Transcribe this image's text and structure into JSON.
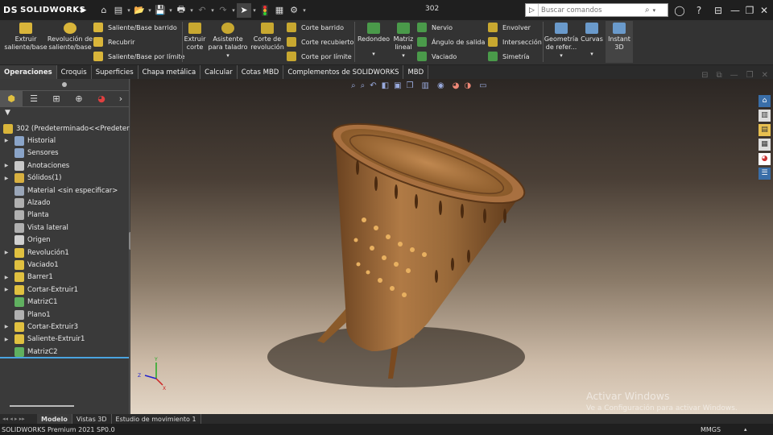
{
  "app": {
    "name": "SOLIDWORKS",
    "brand_mark": "DS",
    "document_title": "302"
  },
  "search": {
    "placeholder": "Buscar comandos"
  },
  "ribbon": {
    "extruir_saliente": "Extruir\nsaliente/base",
    "revolucion_saliente": "Revolución de\nsaliente/base",
    "saliente_barrido": "Saliente/Base barrido",
    "recubrir": "Recubrir",
    "saliente_limite": "Saliente/Base por límite",
    "extruir_corte": "Extruir\ncorte",
    "asistente_taladro": "Asistente\npara taladro",
    "corte_revolucion": "Corte de\nrevolución",
    "corte_barrido": "Corte barrido",
    "corte_recubierto": "Corte recubierto",
    "corte_limite": "Corte por límite",
    "redondeo": "Redondeo",
    "matriz_lineal": "Matriz\nlineal",
    "nervio": "Nervio",
    "angulo_salida": "Ángulo de salida",
    "vaciado": "Vaciado",
    "envolver": "Envolver",
    "interseccion": "Intersección",
    "simetria": "Simetría",
    "geometria_referencia": "Geometría\nde refer...",
    "curvas": "Curvas",
    "instant3d": "Instant\n3D"
  },
  "tabs": [
    "Operaciones",
    "Croquis",
    "Superficies",
    "Chapa metálica",
    "Calcular",
    "Cotas MBD",
    "Complementos de SOLIDWORKS",
    "MBD"
  ],
  "feature_tree": {
    "root": "302  (Predeterminado<<Predeterminado>",
    "items": [
      {
        "label": "Historial",
        "expandable": true,
        "icon_color": "#8aa4c8"
      },
      {
        "label": "Sensores",
        "expandable": false,
        "icon_color": "#8aa4c8"
      },
      {
        "label": "Anotaciones",
        "expandable": true,
        "icon_color": "#c8c8c8"
      },
      {
        "label": "Sólidos(1)",
        "expandable": true,
        "icon_color": "#d8b040"
      },
      {
        "label": "Material <sin especificar>",
        "expandable": false,
        "icon_color": "#9aa6b8"
      },
      {
        "label": "Alzado",
        "expandable": false,
        "icon_color": "#b0b0b0"
      },
      {
        "label": "Planta",
        "expandable": false,
        "icon_color": "#b0b0b0"
      },
      {
        "label": "Vista lateral",
        "expandable": false,
        "icon_color": "#b0b0b0"
      },
      {
        "label": "Origen",
        "expandable": false,
        "icon_color": "#d0d0d0"
      },
      {
        "label": "Revolución1",
        "expandable": true,
        "icon_color": "#e0c040"
      },
      {
        "label": "Vaciado1",
        "expandable": false,
        "icon_color": "#e0c040"
      },
      {
        "label": "Barrer1",
        "expandable": true,
        "icon_color": "#e0c040"
      },
      {
        "label": "Cortar-Extruir1",
        "expandable": true,
        "icon_color": "#e0c040"
      },
      {
        "label": "MatrizC1",
        "expandable": false,
        "icon_color": "#60b060"
      },
      {
        "label": "Plano1",
        "expandable": false,
        "icon_color": "#b0b0b0"
      },
      {
        "label": "Cortar-Extruir3",
        "expandable": true,
        "icon_color": "#e0c040"
      },
      {
        "label": "Saliente-Extruir1",
        "expandable": true,
        "icon_color": "#e0c040"
      },
      {
        "label": "MatrizC2",
        "expandable": false,
        "icon_color": "#60b060"
      }
    ]
  },
  "bottom_tabs": [
    "Modelo",
    "Vistas 3D",
    "Estudio de movimiento 1"
  ],
  "status": {
    "version": "SOLIDWORKS Premium 2021 SP0.0",
    "units": "MMGS"
  },
  "watermark": {
    "title": "Activar Windows",
    "subtitle": "Ve a Configuración para activar Windows."
  },
  "colors": {
    "part_bronze": "#9a6a3a",
    "accent": "#e0c040",
    "panel": "#3a3a3a"
  }
}
